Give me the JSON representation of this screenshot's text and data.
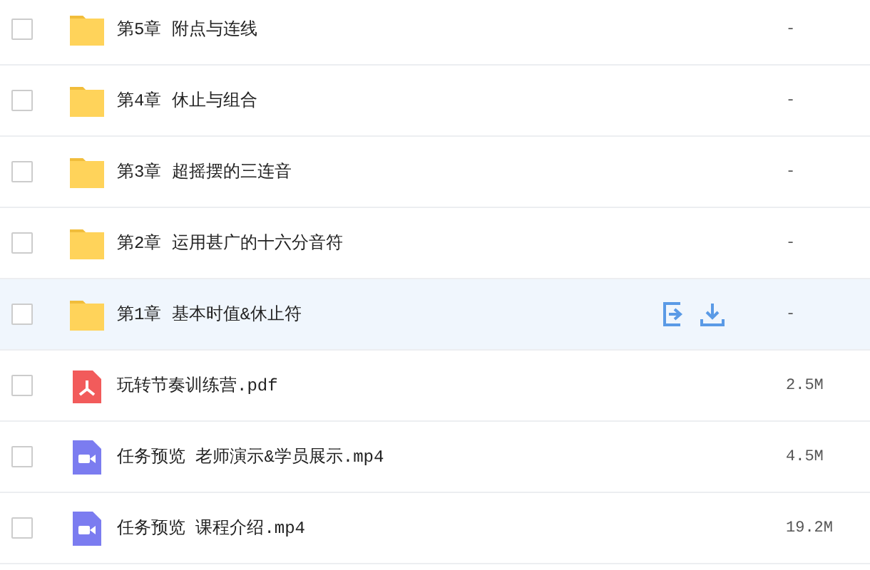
{
  "files": [
    {
      "kind": "folder",
      "name": "第5章 附点与连线",
      "size": "-",
      "checked": false,
      "hovered": false
    },
    {
      "kind": "folder",
      "name": "第4章 休止与组合",
      "size": "-",
      "checked": false,
      "hovered": false
    },
    {
      "kind": "folder",
      "name": "第3章 超摇摆的三连音",
      "size": "-",
      "checked": false,
      "hovered": false
    },
    {
      "kind": "folder",
      "name": "第2章 运用甚广的十六分音符",
      "size": "-",
      "checked": false,
      "hovered": false
    },
    {
      "kind": "folder",
      "name": "第1章 基本时值&休止符",
      "size": "-",
      "checked": false,
      "hovered": true
    },
    {
      "kind": "pdf",
      "name": "玩转节奏训练营.pdf",
      "size": "2.5M",
      "checked": false,
      "hovered": false
    },
    {
      "kind": "video",
      "name": "任务预览 老师演示&学员展示.mp4",
      "size": "4.5M",
      "checked": false,
      "hovered": false
    },
    {
      "kind": "video",
      "name": "任务预览 课程介绍.mp4",
      "size": "19.2M",
      "checked": false,
      "hovered": false
    }
  ]
}
